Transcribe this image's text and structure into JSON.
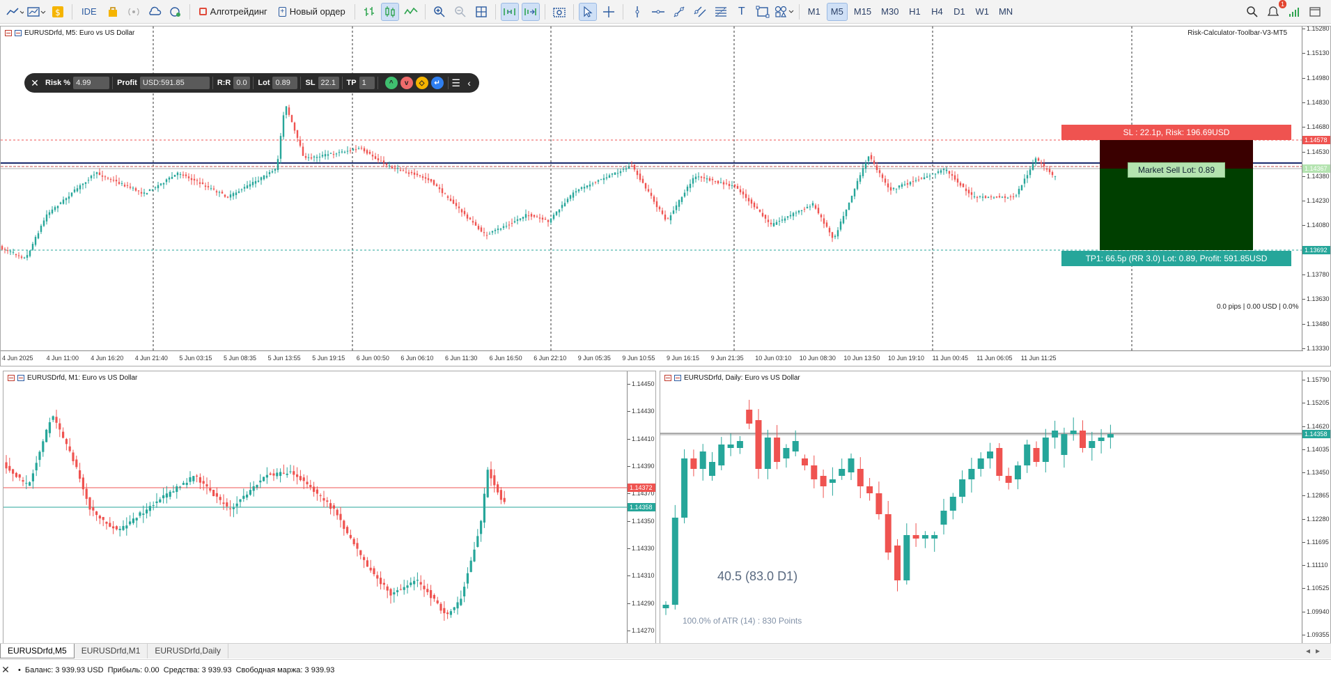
{
  "toolbar": {
    "algo_label": "Алготрейдинг",
    "new_order_label": "Новый ордер",
    "ide_label": "IDE",
    "timeframes": [
      "M1",
      "M5",
      "M15",
      "M30",
      "H1",
      "H4",
      "D1",
      "W1",
      "MN"
    ],
    "active_timeframe": "M5",
    "notifications_count": "1"
  },
  "main_chart": {
    "title": "EURUSDrfd, M5:  Euro vs US Dollar",
    "indicator_label": "Risk-Calculator-Toolbar-V3-MT5",
    "price_ticks": [
      "1.15280",
      "1.15130",
      "1.14980",
      "1.14830",
      "1.14680",
      "1.14530",
      "1.14380",
      "1.14230",
      "1.14080",
      "1.13930",
      "1.13780",
      "1.13630",
      "1.13480",
      "1.13330"
    ],
    "price_tags": {
      "sl": "1.14578",
      "current": "1.14367",
      "tp": "1.13692"
    },
    "time_labels": [
      "4 Jun 2025",
      "4 Jun 11:00",
      "4 Jun 16:20",
      "4 Jun 21:40",
      "5 Jun 03:15",
      "5 Jun 08:35",
      "5 Jun 13:55",
      "5 Jun 19:15",
      "6 Jun 00:50",
      "6 Jun 06:10",
      "6 Jun 11:30",
      "6 Jun 16:50",
      "6 Jun 22:10",
      "9 Jun 05:35",
      "9 Jun 10:55",
      "9 Jun 16:15",
      "9 Jun 21:35",
      "10 Jun 03:10",
      "10 Jun 08:30",
      "10 Jun 13:50",
      "10 Jun 19:10",
      "11 Jun 00:45",
      "11 Jun 06:05",
      "11 Jun 11:25"
    ],
    "sl_label": "SL : 22.1p, Risk: 196.69USD",
    "market_label": "Market Sell Lot: 0.89",
    "tp_label": "TP1: 66.5p (RR 3.0) Lot: 0.89, Profit: 591.85USD",
    "status_label": "0.0 pips | 0.00 USD | 0.0%"
  },
  "risk_toolbar": {
    "close": "✕",
    "risk_label": "Risk %",
    "risk_value": "4.99",
    "profit_label": "Profit",
    "profit_value": "USD:591.85",
    "rr_label": "R:R",
    "rr_value": "0.0",
    "lot_label": "Lot",
    "lot_value": "0.89",
    "sl_label": "SL",
    "sl_value": "22.1",
    "tp_label": "TP",
    "tp_value": "1",
    "menu": "☰",
    "collapse": "‹"
  },
  "m1_chart": {
    "title": "EURUSDrfd, M1:  Euro vs US Dollar",
    "price_ticks": [
      "1.14450",
      "1.14430",
      "1.14410",
      "1.14390",
      "1.14370",
      "1.14350",
      "1.14330",
      "1.14310",
      "1.14290",
      "1.14270"
    ],
    "price_tags": {
      "ask": "1.14372",
      "bid": "1.14358"
    }
  },
  "d1_chart": {
    "title": "EURUSDrfd, Daily:  Euro vs US Dollar",
    "price_ticks": [
      "1.15790",
      "1.15205",
      "1.14620",
      "1.14035",
      "1.13450",
      "1.12865",
      "1.12280",
      "1.11695",
      "1.11110",
      "1.10525",
      "1.09940",
      "1.09355"
    ],
    "price_tag": "1.14358",
    "atr_main": "40.5 (83.0 D1)",
    "atr_sub": "100.0% of ATR (14) : 830 Points"
  },
  "tabs": [
    "EURUSDrfd,M5",
    "EURUSDrfd,M1",
    "EURUSDrfd,Daily"
  ],
  "active_tab": "EURUSDrfd,M5",
  "status_bar": {
    "text": "Баланс: 3 939.93 USD  Прибыль: 0.00  Средства: 3 939.93  Свободная маржа: 3 939.93"
  },
  "colors": {
    "bull": "#26a69a",
    "bear": "#ef5350",
    "sl": "#ef5350",
    "tp": "#26a69a",
    "risk_zone": "#3a0000",
    "reward_zone": "#003f00",
    "accent": "#2a5aa0"
  },
  "icons": [
    "line-chart-icon",
    "chart-type-icon",
    "dollar-icon",
    "ide-icon",
    "bag-icon",
    "signal-icon",
    "cloud-icon",
    "vps-icon",
    "algo-icon",
    "new-order-icon",
    "bar-chart-icon",
    "candles-icon",
    "line-icon",
    "zoom-in-icon",
    "zoom-out-icon",
    "grid-icon",
    "autoscroll-icon",
    "shift-icon",
    "screenshot-icon",
    "cursor-icon",
    "crosshair-icon",
    "vertical-line-icon",
    "horizontal-line-icon",
    "trend-line-icon",
    "channel-icon",
    "fibonacci-icon",
    "text-icon",
    "shapes-icon",
    "arrows-icon",
    "search-icon",
    "notification-icon",
    "signal-strength-icon",
    "window-icon"
  ]
}
